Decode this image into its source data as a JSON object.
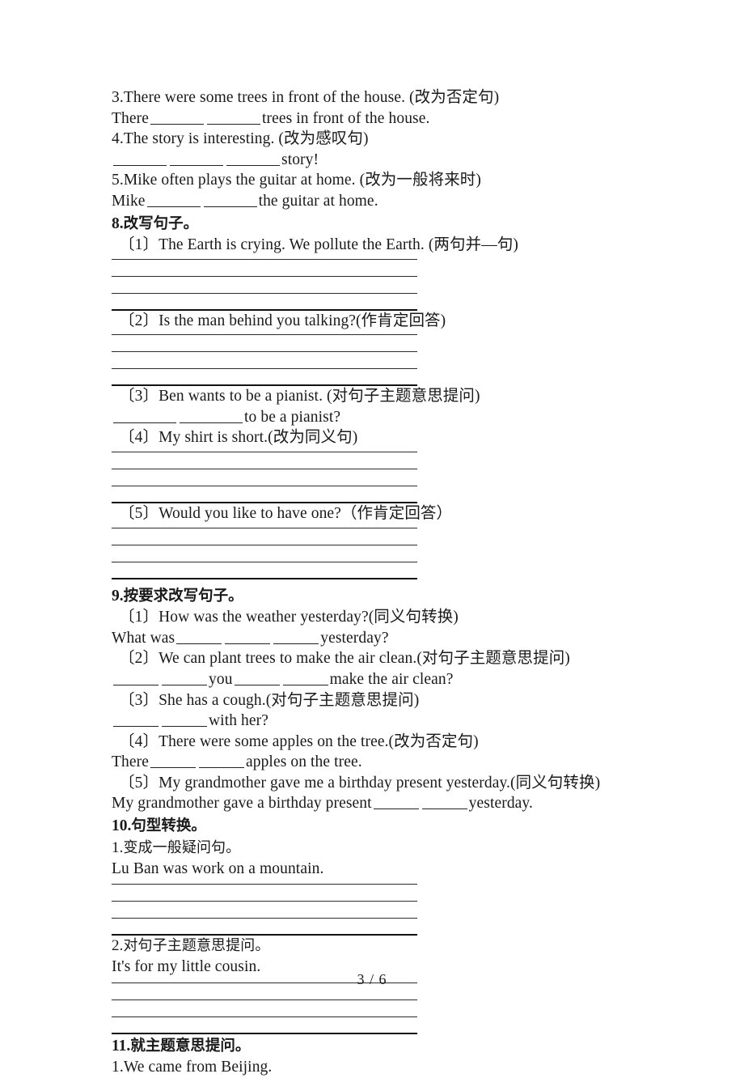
{
  "page": {
    "footer": "3 / 6"
  },
  "carryover": {
    "q3_prompt": "3.There were some trees in front of the house. (改为否定句)",
    "q3_answer_pre": "There",
    "q3_answer_post": "trees in front of the house.",
    "q4_prompt": "4.The story is interesting. (改为感叹句)",
    "q4_answer_post": "story!",
    "q5_prompt": "5.Mike often plays the guitar at home. (改为一般将来时)",
    "q5_answer_pre": "Mike",
    "q5_answer_post": "the guitar at home."
  },
  "section8": {
    "number": "8.",
    "title": "改写句子。",
    "items": [
      {
        "label": "〔1〕",
        "text": "The Earth is crying. We pollute the Earth. (两句并—句)"
      },
      {
        "label": "〔2〕",
        "text": "Is the man behind you talking?(作肯定回答)"
      },
      {
        "label": "〔3〕",
        "text": "Ben wants to be a pianist. (对句子主题意思提问)"
      },
      {
        "label": "〔4〕",
        "text": "My shirt is short.(改为同义句)"
      },
      {
        "label": "〔5〕",
        "text": "Would you like to have one?（作肯定回答）"
      }
    ],
    "q3_answer_post": "to be a pianist?"
  },
  "section9": {
    "number": "9.",
    "title": "按要求改写句子。",
    "items": [
      {
        "label": "〔1〕",
        "text": "How was the weather yesterday?(同义句转换)"
      },
      {
        "label": "〔2〕",
        "text": "We can plant trees to make the air clean.(对句子主题意思提问)"
      },
      {
        "label": "〔3〕",
        "text": "She has a cough.(对句子主题意思提问)"
      },
      {
        "label": "〔4〕",
        "text": "There were some apples on the tree.(改为否定句)"
      },
      {
        "label": "〔5〕",
        "text": "My grandmother gave me a birthday present yesterday.(同义句转换)"
      }
    ],
    "a1_pre": "What was",
    "a1_post": "yesterday?",
    "a2_mid": "you",
    "a2_post": "make the air clean?",
    "a3_post": "with her?",
    "a4_pre": "There",
    "a4_post": "apples on the tree.",
    "a5_pre": "My grandmother gave a birthday present",
    "a5_post": "yesterday."
  },
  "section10": {
    "number": "10.",
    "title": "句型转换。",
    "items": [
      {
        "label": "1.",
        "instruction": "变成一般疑问句。",
        "sentence": "Lu Ban was work on a mountain."
      },
      {
        "label": "2.",
        "instruction": "对句子主题意思提问。",
        "sentence": "It's for my little cousin."
      }
    ]
  },
  "section11": {
    "number": "11.",
    "title": "就主题意思提问。",
    "items": [
      {
        "label": "1.",
        "sentence": "We came from Beijing."
      }
    ]
  }
}
